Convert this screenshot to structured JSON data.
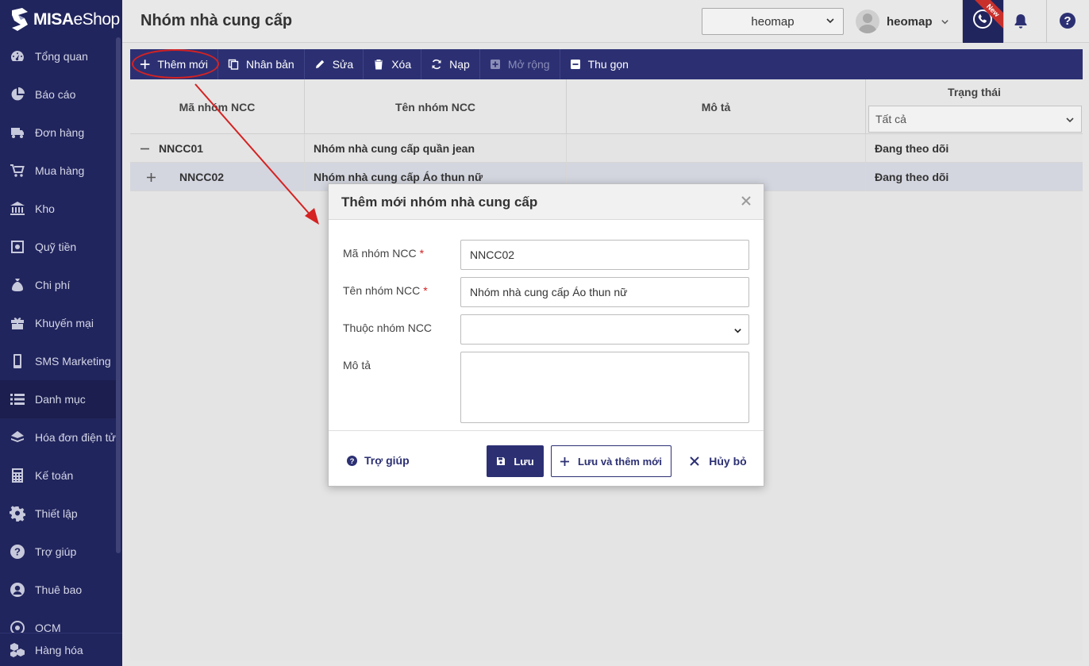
{
  "app": {
    "logo_brand": "MISA",
    "logo_product": "eShop"
  },
  "sidebar": {
    "items": [
      {
        "label": "Tổng quan",
        "icon": "dashboard-icon"
      },
      {
        "label": "Báo cáo",
        "icon": "pie-chart-icon"
      },
      {
        "label": "Đơn hàng",
        "icon": "order-icon"
      },
      {
        "label": "Mua hàng",
        "icon": "cart-icon"
      },
      {
        "label": "Kho",
        "icon": "warehouse-icon"
      },
      {
        "label": "Quỹ tiền",
        "icon": "safe-icon"
      },
      {
        "label": "Chi phí",
        "icon": "money-bag-icon"
      },
      {
        "label": "Khuyến mại",
        "icon": "gift-icon"
      },
      {
        "label": "SMS Marketing",
        "icon": "phone-icon"
      },
      {
        "label": "Danh mục",
        "icon": "list-icon",
        "active": true
      },
      {
        "label": "Hóa đơn điện tử",
        "icon": "invoice-icon"
      },
      {
        "label": "Kế toán",
        "icon": "calculator-icon"
      },
      {
        "label": "Thiết lập",
        "icon": "gear-icon"
      },
      {
        "label": "Trợ giúp",
        "icon": "question-icon"
      },
      {
        "label": "Thuê bao",
        "icon": "user-circle-icon"
      },
      {
        "label": "OCM",
        "icon": "ocm-icon"
      }
    ],
    "bottom_item": {
      "label": "Hàng hóa",
      "icon": "boxes-icon"
    }
  },
  "header": {
    "title": "Nhóm nhà cung cấp",
    "store_select": "heomap",
    "user_name": "heomap",
    "new_badge": "New"
  },
  "toolbar": {
    "add": "Thêm mới",
    "duplicate": "Nhân bản",
    "edit": "Sửa",
    "delete": "Xóa",
    "reload": "Nạp",
    "expand": "Mở rộng",
    "collapse": "Thu gọn"
  },
  "grid": {
    "columns": {
      "code": "Mã nhóm NCC",
      "name": "Tên nhóm NCC",
      "description": "Mô tả",
      "status": "Trạng thái"
    },
    "status_filter": "Tất cả",
    "rows": [
      {
        "code": "NNCC01",
        "name": "Nhóm nhà cung cấp quần jean",
        "description": "",
        "status": "Đang theo dõi",
        "toggle": "collapse"
      },
      {
        "code": "NNCC02",
        "name": "Nhóm nhà cung cấp Áo thun nữ",
        "description": "",
        "status": "Đang theo dõi",
        "toggle": "expand"
      }
    ]
  },
  "dialog": {
    "title": "Thêm mới nhóm nhà cung cấp",
    "fields": {
      "code_label": "Mã nhóm NCC",
      "code_value": "NNCC02",
      "name_label": "Tên nhóm NCC",
      "name_value": "Nhóm nhà cung cấp Áo thun nữ",
      "parent_label": "Thuộc nhóm NCC",
      "parent_value": "",
      "description_label": "Mô tả",
      "description_value": "",
      "required_mark": "*"
    },
    "help": "Trợ giúp",
    "save": "Lưu",
    "save_and_new": "Lưu và thêm mới",
    "cancel": "Hủy bỏ"
  },
  "colors": {
    "sidebar_bg": "#21255d",
    "toolbar_bg": "#2c3073",
    "primary": "#2c3073",
    "required": "#d12020",
    "annotation": "#d52222"
  }
}
